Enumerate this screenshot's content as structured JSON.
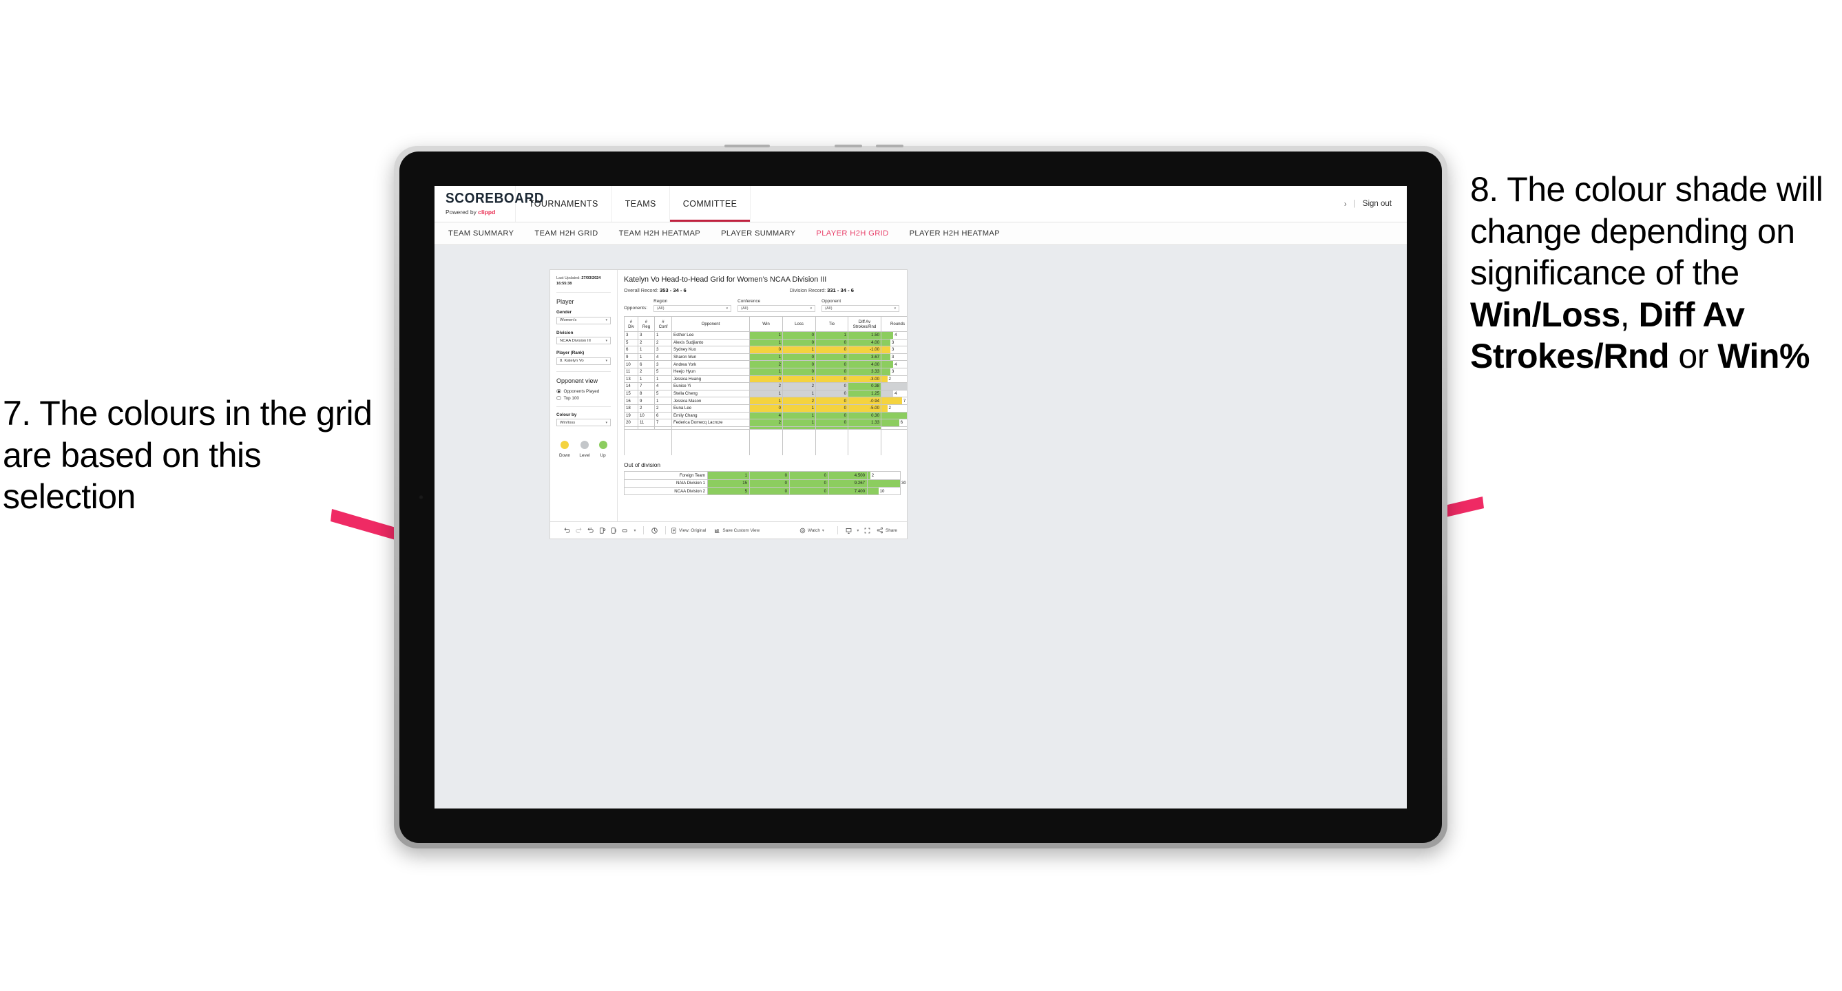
{
  "annotations": {
    "left": {
      "id": "annot-7",
      "text": "7. The colours in the grid are based on this selection"
    },
    "right": {
      "id": "annot-8",
      "lead": "8. The colour shade will change depending on significance of the ",
      "bold1": "Win/Loss",
      "mid1": ", ",
      "bold2": "Diff Av Strokes/Rnd",
      "mid2": " or ",
      "bold3": "Win%"
    }
  },
  "header": {
    "brand_name": "SCOREBOARD",
    "brand_sub_prefix": "Powered by ",
    "brand_sub_brand": "clippd",
    "top_nav": [
      {
        "label": "TOURNAMENTS",
        "active": false
      },
      {
        "label": "TEAMS",
        "active": false
      },
      {
        "label": "COMMITTEE",
        "active": true
      }
    ],
    "chevron": "›",
    "separator": "|",
    "sign_out": "Sign out"
  },
  "sub_nav": [
    {
      "label": "TEAM SUMMARY",
      "active": false
    },
    {
      "label": "TEAM H2H GRID",
      "active": false
    },
    {
      "label": "TEAM H2H HEATMAP",
      "active": false
    },
    {
      "label": "PLAYER SUMMARY",
      "active": false
    },
    {
      "label": "PLAYER H2H GRID",
      "active": true
    },
    {
      "label": "PLAYER H2H HEATMAP",
      "active": false
    }
  ],
  "sidebar": {
    "last_updated_label": "Last Updated:",
    "last_updated_date": "27/03/2024",
    "last_updated_time": "16:55:38",
    "player_heading": "Player",
    "gender_label": "Gender",
    "gender_value": "Women’s",
    "division_label": "Division",
    "division_value": "NCAA Division III",
    "player_rank_label": "Player (Rank)",
    "player_rank_value": "8. Katelyn Vo",
    "opponent_view_heading": "Opponent view",
    "opponent_view_options": [
      {
        "label": "Opponents Played",
        "selected": true
      },
      {
        "label": "Top 100",
        "selected": false
      }
    ],
    "colour_by_label": "Colour by",
    "colour_by_value": "Win/loss",
    "legend": [
      {
        "label": "Down",
        "color": "#f4d33f"
      },
      {
        "label": "Level",
        "color": "#c3c6c9"
      },
      {
        "label": "Up",
        "color": "#8ccd5f"
      }
    ]
  },
  "main": {
    "title": "Katelyn Vo Head-to-Head Grid for Women’s NCAA Division III",
    "overall_record_label": "Overall Record:",
    "overall_record_value": "353 -  34 - 6",
    "division_record_label": "Division Record:",
    "division_record_value": "331 -  34 - 6",
    "opponents_label": "Opponents:",
    "filters": [
      {
        "label": "Region",
        "value": "(All)"
      },
      {
        "label": "Conference",
        "value": "(All)"
      },
      {
        "label": "Opponent",
        "value": "(All)"
      }
    ],
    "out_of_division_title": "Out of division"
  },
  "chart_data": {
    "type": "table",
    "title": "Katelyn Vo Head-to-Head Grid for Women’s NCAA Division III",
    "columns": [
      "# Div",
      "# Reg",
      "# Conf",
      "Opponent",
      "Win",
      "Loss",
      "Tie",
      "Diff Av Strokes/Rnd",
      "Rounds"
    ],
    "column_headers_multiline": [
      {
        "l1": "#",
        "l2": "Div"
      },
      {
        "l1": "#",
        "l2": "Reg"
      },
      {
        "l1": "#",
        "l2": "Conf"
      },
      {
        "l1": "Opponent",
        "l2": ""
      },
      {
        "l1": "Win",
        "l2": ""
      },
      {
        "l1": "Loss",
        "l2": ""
      },
      {
        "l1": "Tie",
        "l2": ""
      },
      {
        "l1": "Diff Av",
        "l2": "Strokes/Rnd"
      },
      {
        "l1": "Rounds",
        "l2": ""
      }
    ],
    "rounds_max": 11,
    "colors": {
      "up": "#8ccd5f",
      "down": "#f4d33f",
      "level": "#d0d2d4"
    },
    "rows": [
      {
        "div": "3",
        "reg": "3",
        "conf": "1",
        "opponent": "Esther Lee",
        "win": "1",
        "loss": "0",
        "tie": "1",
        "diff": "1.50",
        "rounds": "4",
        "state": "up"
      },
      {
        "div": "5",
        "reg": "2",
        "conf": "2",
        "opponent": "Alexis Sudjianto",
        "win": "1",
        "loss": "0",
        "tie": "0",
        "diff": "4.00",
        "rounds": "3",
        "state": "up"
      },
      {
        "div": "6",
        "reg": "1",
        "conf": "3",
        "opponent": "Sydney Kuo",
        "win": "0",
        "loss": "1",
        "tie": "0",
        "diff": "-1.00",
        "rounds": "3",
        "state": "down"
      },
      {
        "div": "9",
        "reg": "1",
        "conf": "4",
        "opponent": "Sharon Mun",
        "win": "1",
        "loss": "0",
        "tie": "0",
        "diff": "3.67",
        "rounds": "3",
        "state": "up"
      },
      {
        "div": "10",
        "reg": "6",
        "conf": "3",
        "opponent": "Andrea York",
        "win": "2",
        "loss": "0",
        "tie": "0",
        "diff": "4.00",
        "rounds": "4",
        "state": "up"
      },
      {
        "div": "11",
        "reg": "2",
        "conf": "5",
        "opponent": "Heejo Hyun",
        "win": "1",
        "loss": "0",
        "tie": "0",
        "diff": "3.33",
        "rounds": "3",
        "state": "up"
      },
      {
        "div": "13",
        "reg": "1",
        "conf": "1",
        "opponent": "Jessica Huang",
        "win": "0",
        "loss": "1",
        "tie": "0",
        "diff": "-3.00",
        "rounds": "2",
        "state": "down"
      },
      {
        "div": "14",
        "reg": "7",
        "conf": "4",
        "opponent": "Eunice Yi",
        "win": "2",
        "loss": "2",
        "tie": "0",
        "diff": "0.38",
        "rounds": "9",
        "state": "level",
        "diff_state": "up"
      },
      {
        "div": "15",
        "reg": "8",
        "conf": "5",
        "opponent": "Stella Cheng",
        "win": "1",
        "loss": "1",
        "tie": "0",
        "diff": "1.25",
        "rounds": "4",
        "state": "level",
        "diff_state": "up"
      },
      {
        "div": "16",
        "reg": "9",
        "conf": "1",
        "opponent": "Jessica Mason",
        "win": "1",
        "loss": "2",
        "tie": "0",
        "diff": "-0.94",
        "rounds": "7",
        "state": "down"
      },
      {
        "div": "18",
        "reg": "2",
        "conf": "2",
        "opponent": "Euna Lee",
        "win": "0",
        "loss": "1",
        "tie": "0",
        "diff": "-5.00",
        "rounds": "2",
        "state": "down"
      },
      {
        "div": "19",
        "reg": "10",
        "conf": "6",
        "opponent": "Emily Chang",
        "win": "4",
        "loss": "1",
        "tie": "0",
        "diff": "0.30",
        "rounds": "11",
        "state": "up"
      },
      {
        "div": "20",
        "reg": "11",
        "conf": "7",
        "opponent": "Federica Domecq Lacroze",
        "win": "2",
        "loss": "1",
        "tie": "0",
        "diff": "1.33",
        "rounds": "6",
        "state": "up"
      }
    ],
    "out_of_division": {
      "rounds_max": 30,
      "rows": [
        {
          "name": "Foreign Team",
          "win": "1",
          "loss": "0",
          "tie": "0",
          "diff": "4.500",
          "rounds": "2",
          "state": "up"
        },
        {
          "name": "NAIA Division 1",
          "win": "15",
          "loss": "0",
          "tie": "0",
          "diff": "9.267",
          "rounds": "30",
          "state": "up"
        },
        {
          "name": "NCAA Division 2",
          "win": "5",
          "loss": "0",
          "tie": "0",
          "diff": "7.400",
          "rounds": "10",
          "state": "up"
        }
      ]
    }
  },
  "toolbar": {
    "view_label": "View: Original",
    "save_label": "Save Custom View",
    "watch_label": "Watch",
    "share_label": "Share"
  }
}
